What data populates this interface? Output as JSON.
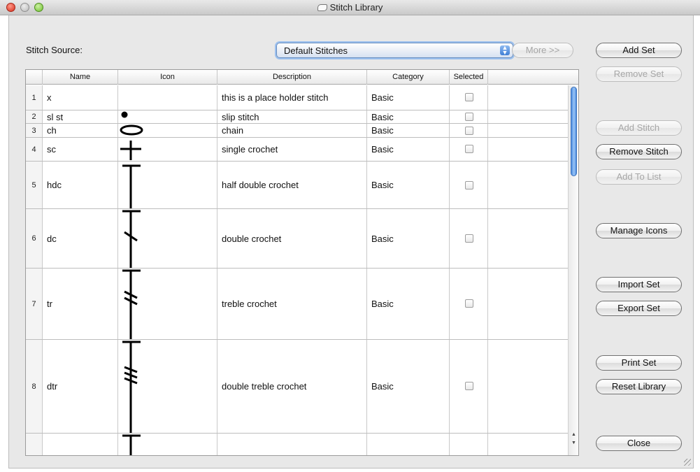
{
  "window": {
    "title": "Stitch Library"
  },
  "source": {
    "label": "Stitch Source:",
    "selected": "Default Stitches",
    "more_label": "More >>"
  },
  "buttons": {
    "add_set": "Add Set",
    "remove_set": "Remove Set",
    "add_stitch": "Add Stitch",
    "remove_stitch": "Remove Stitch",
    "add_to_list": "Add To List",
    "manage_icons": "Manage Icons",
    "import_set": "Import Set",
    "export_set": "Export Set",
    "print_set": "Print Set",
    "reset_library": "Reset Library",
    "close": "Close"
  },
  "table": {
    "columns": [
      "Name",
      "Icon",
      "Description",
      "Category",
      "Selected"
    ],
    "rows": [
      {
        "num": "1",
        "name": "x",
        "icon": "blank",
        "description": "this is a place holder stitch",
        "category": "Basic",
        "selected": false
      },
      {
        "num": "2",
        "name": "sl st",
        "icon": "slip-stitch-dot",
        "description": "slip stitch",
        "category": "Basic",
        "selected": false
      },
      {
        "num": "3",
        "name": "ch",
        "icon": "chain-oval",
        "description": "chain",
        "category": "Basic",
        "selected": false
      },
      {
        "num": "4",
        "name": "sc",
        "icon": "single-crochet-cross",
        "description": "single crochet",
        "category": "Basic",
        "selected": false
      },
      {
        "num": "5",
        "name": "hdc",
        "icon": "half-double-crochet-symbol",
        "description": "half double crochet",
        "category": "Basic",
        "selected": false
      },
      {
        "num": "6",
        "name": "dc",
        "icon": "double-crochet-symbol",
        "description": "double crochet",
        "category": "Basic",
        "selected": false
      },
      {
        "num": "7",
        "name": "tr",
        "icon": "treble-crochet-symbol",
        "description": "treble crochet",
        "category": "Basic",
        "selected": false
      },
      {
        "num": "8",
        "name": "dtr",
        "icon": "double-treble-crochet-symbol",
        "description": "double treble crochet",
        "category": "Basic",
        "selected": false
      },
      {
        "num": "",
        "name": "",
        "icon": "partial-stitch-symbol",
        "description": "",
        "category": "",
        "selected": null
      }
    ]
  },
  "colors": {
    "accent": "#3f7fd6",
    "window_bg": "#e8e8e8"
  }
}
